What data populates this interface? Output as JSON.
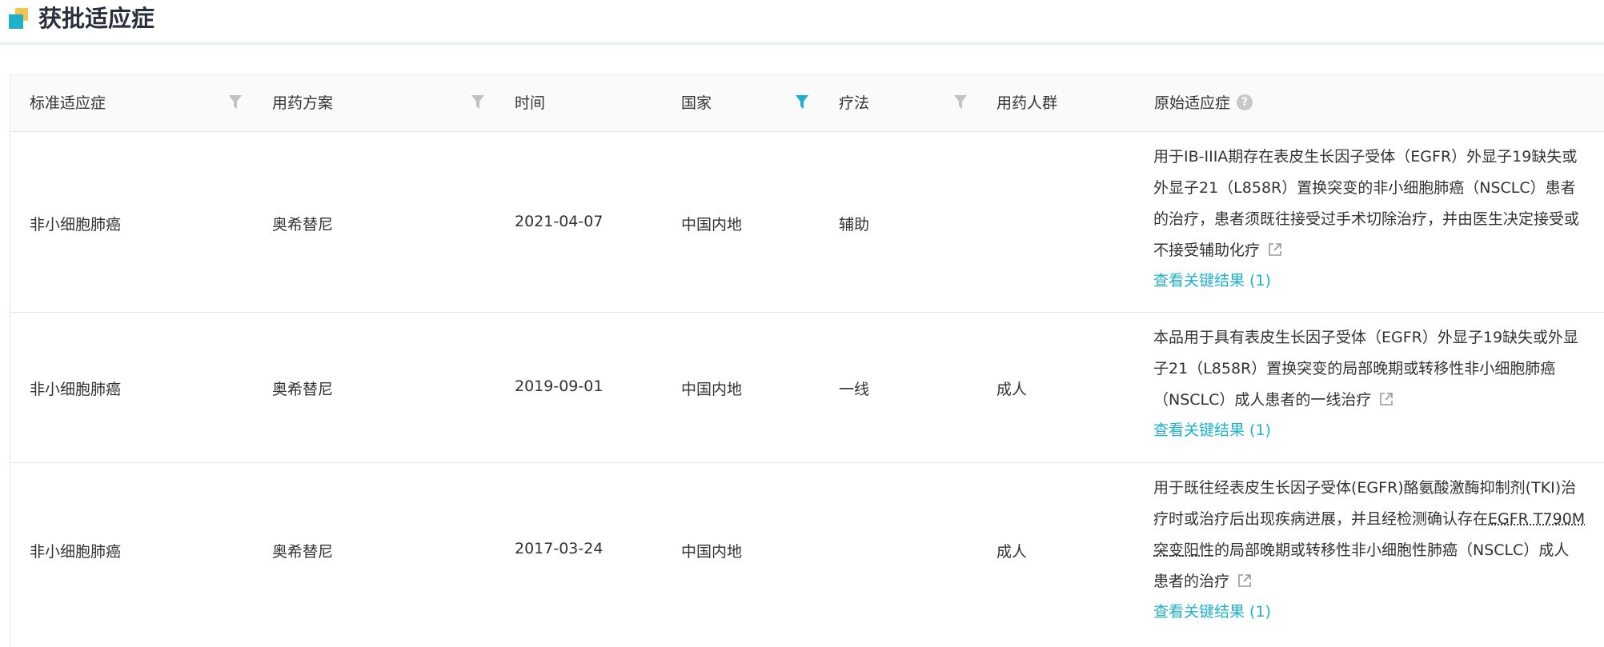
{
  "section": {
    "title": "获批适应症"
  },
  "table": {
    "columns": [
      {
        "label": "标准适应症"
      },
      {
        "label": "用药方案"
      },
      {
        "label": "时间"
      },
      {
        "label": "国家"
      },
      {
        "label": "疗法"
      },
      {
        "label": "用药人群"
      },
      {
        "label": "原始适应症"
      }
    ],
    "rows": [
      {
        "indication": "非小细胞肺癌",
        "regimen": "奥希替尼",
        "date": "2021-04-07",
        "country": "中国内地",
        "therapy": "辅助",
        "population": "",
        "orig_lines": [
          "用于IB-IIIA期存在表皮生长因子受体（EGFR）外显子19缺失或",
          "外显子21（L858R）置换突变的非小细胞肺癌（NSCLC）患者",
          "的治疗，患者须既往接受过手术切除治疗，并由医生决定接受或",
          "不接受辅助化疗"
        ],
        "link": "查看关键结果 (1)"
      },
      {
        "indication": "非小细胞肺癌",
        "regimen": "奥希替尼",
        "date": "2019-09-01",
        "country": "中国内地",
        "therapy": "一线",
        "population": "成人",
        "orig_lines": [
          "本品用于具有表皮生长因子受体（EGFR）外显子19缺失或外显",
          "子21（L858R）置换突变的局部晚期或转移性非小细胞肺癌",
          "（NSCLC）成人患者的一线治疗"
        ],
        "link": "查看关键结果 (1)"
      },
      {
        "indication": "非小细胞肺癌",
        "regimen": "奥希替尼",
        "date": "2017-03-24",
        "country": "中国内地",
        "therapy": "",
        "population": "成人",
        "orig_line1": "用于既往经表皮生长因子受体(EGFR)酪氨酸激酶抑制剂(TKI)治",
        "orig_line2_pre": "疗时或治疗后出现疾病进展，并且经检测确认存在",
        "orig_line2_link": "EGFR T790M",
        "orig_line3_link": "突变阳性",
        "orig_line3_post": "的局部晚期或转移性非小细胞性肺癌（NSCLC）成人",
        "orig_line4": "患者的治疗",
        "link": "查看关键结果 (1)"
      }
    ]
  },
  "colors": {
    "accent": "#1fb1c9",
    "filter_inactive": "#c2c2c2",
    "filter_active": "#1fb1c9"
  }
}
